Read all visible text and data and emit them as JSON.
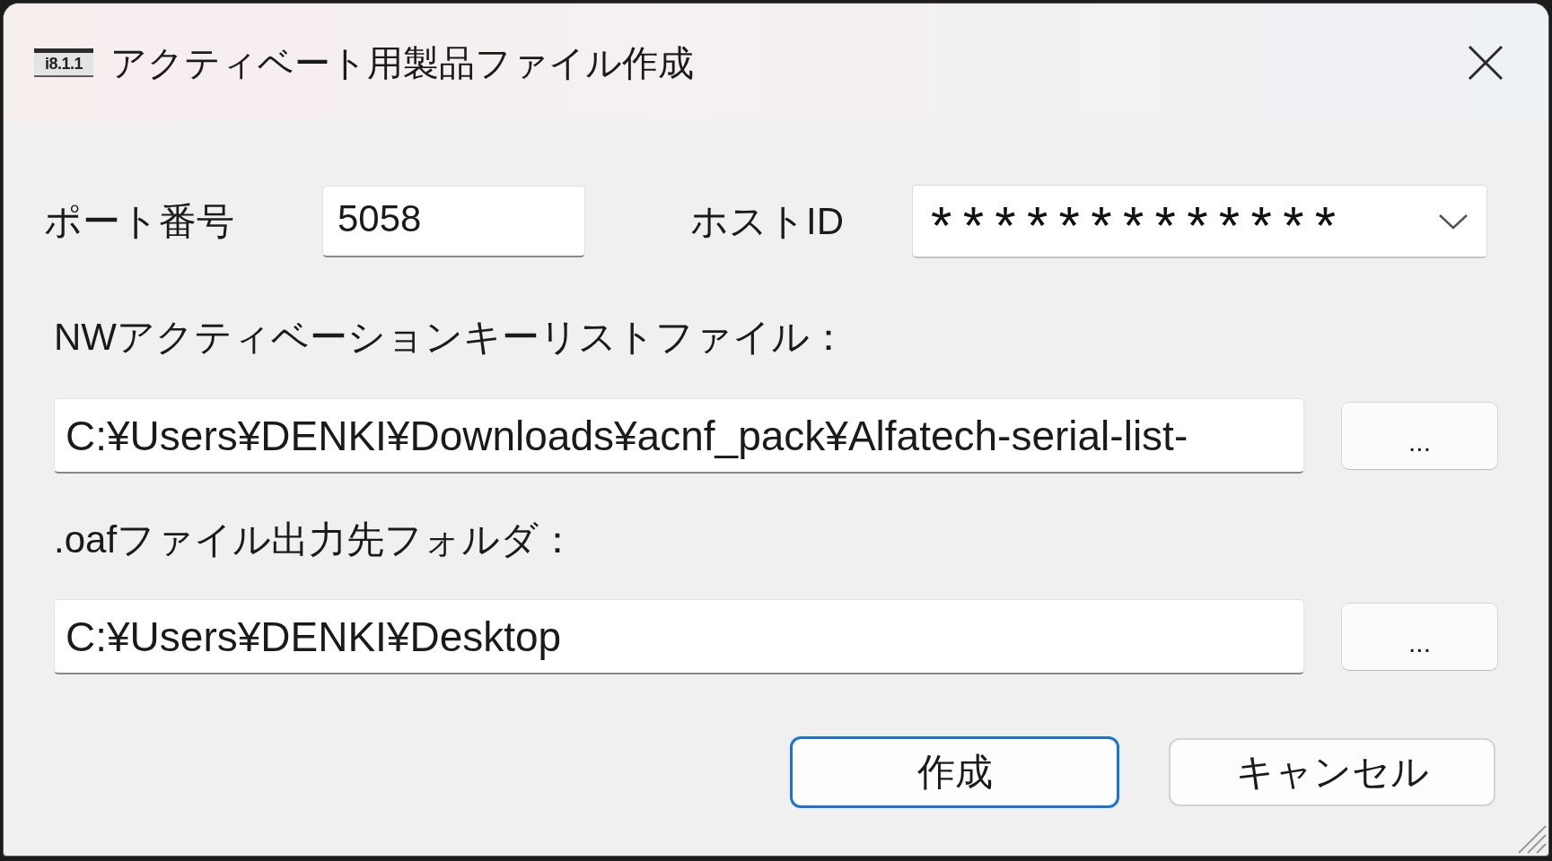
{
  "window": {
    "title": "アクティベート用製品ファイル作成",
    "icon_label": "i8.1.1"
  },
  "port": {
    "label": "ポート番号",
    "value": "5058"
  },
  "host_id": {
    "label": "ホストID",
    "value": "*************"
  },
  "key_list_file": {
    "label": "NWアクティベーションキーリストファイル：",
    "value": "C:¥Users¥DENKI¥Downloads¥acnf_pack¥Alfatech-serial-list-",
    "browse_button": "..."
  },
  "output_folder": {
    "label": ".oafファイル出力先フォルダ：",
    "value": "C:¥Users¥DENKI¥Desktop",
    "browse_button": "..."
  },
  "buttons": [
    {
      "label": "作成",
      "default": true
    },
    {
      "label": "キャンセル",
      "default": false
    }
  ]
}
